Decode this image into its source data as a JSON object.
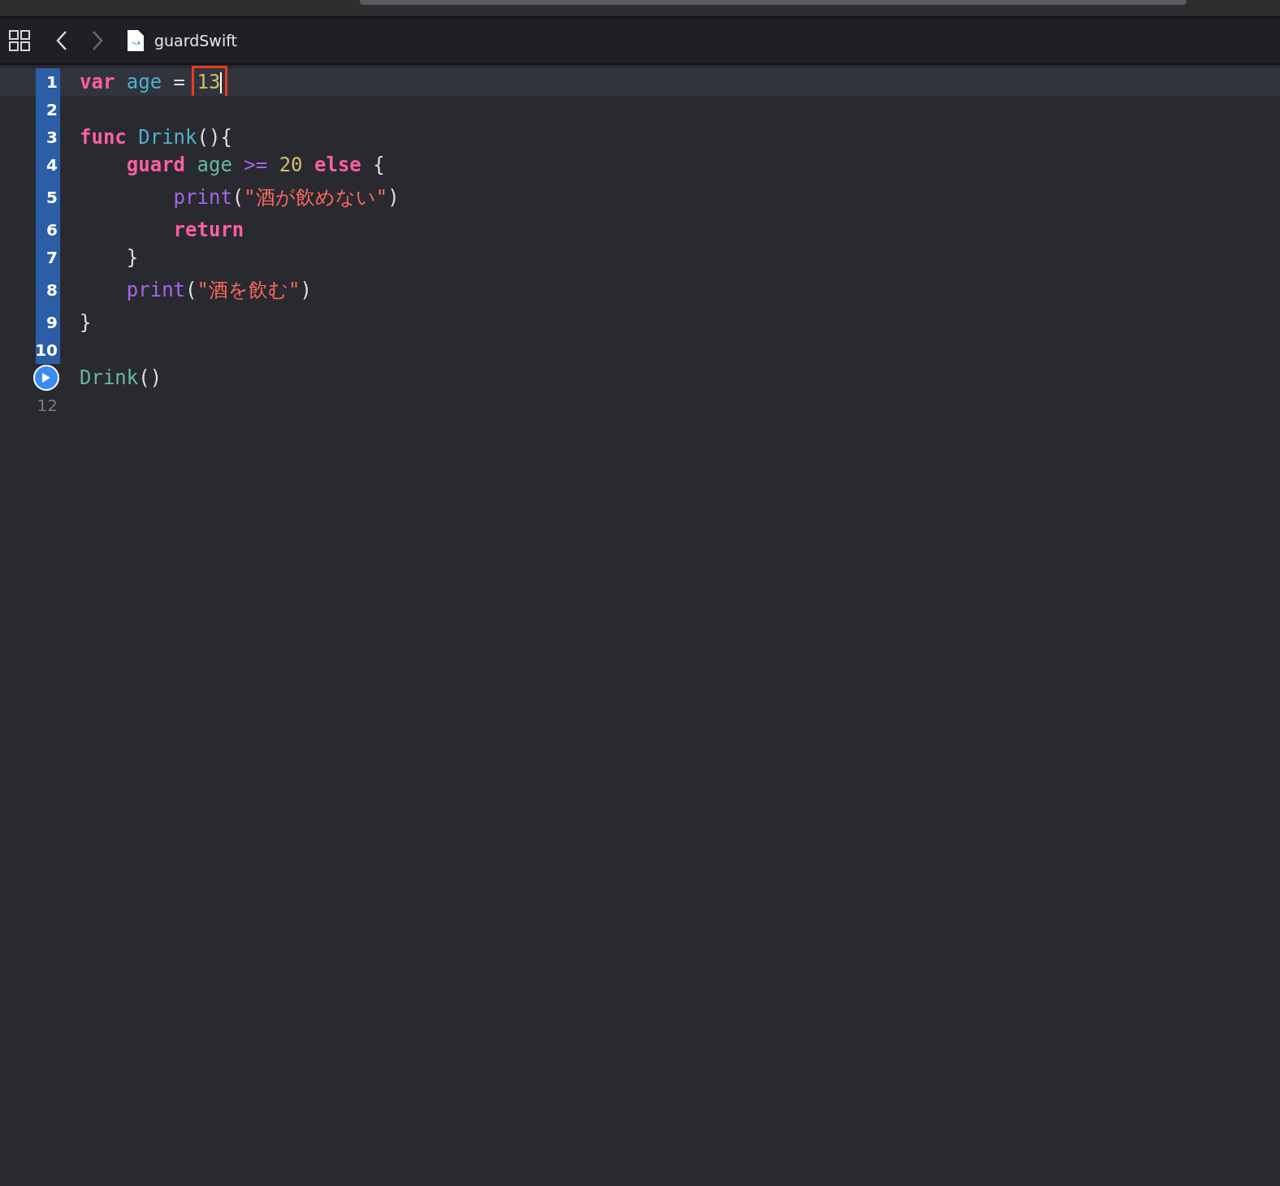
{
  "navigator": {
    "back_enabled": true,
    "forward_enabled": false,
    "file_name": "guardSwift"
  },
  "editor": {
    "lines": [
      {
        "number": "1",
        "kind": "number",
        "executed": true,
        "current": true,
        "tokens": [
          {
            "text": "var",
            "kind": "keyword"
          },
          {
            "text": " age",
            "kind": "decl"
          },
          {
            "text": " = ",
            "kind": "plain"
          },
          {
            "text": "13",
            "kind": "number",
            "boxed": true,
            "cursor": true
          }
        ]
      },
      {
        "number": "2",
        "kind": "number",
        "executed": true,
        "current": false
      },
      {
        "number": "3",
        "kind": "number",
        "executed": true,
        "current": false,
        "tokens": [
          {
            "text": "func",
            "kind": "keyword"
          },
          {
            "text": " Drink",
            "kind": "decl"
          },
          {
            "text": "(){",
            "kind": "plain"
          }
        ]
      },
      {
        "number": "4",
        "kind": "number",
        "executed": true,
        "current": false,
        "tokens": [
          {
            "text": "    guard",
            "kind": "keyword"
          },
          {
            "text": " age",
            "kind": "ident"
          },
          {
            "text": " >=",
            "kind": "func"
          },
          {
            "text": " 20",
            "kind": "number"
          },
          {
            "text": " else",
            "kind": "keyword"
          },
          {
            "text": " {",
            "kind": "plain"
          }
        ]
      },
      {
        "number": "5",
        "kind": "number",
        "executed": true,
        "current": false,
        "tokens": [
          {
            "text": "        print",
            "kind": "func"
          },
          {
            "text": "(",
            "kind": "plain"
          },
          {
            "text": "\"酒が飲めない\"",
            "kind": "string"
          },
          {
            "text": ")",
            "kind": "plain"
          }
        ]
      },
      {
        "number": "6",
        "kind": "number",
        "executed": true,
        "current": false,
        "tokens": [
          {
            "text": "        return",
            "kind": "keyword"
          }
        ]
      },
      {
        "number": "7",
        "kind": "number",
        "executed": true,
        "current": false,
        "tokens": [
          {
            "text": "    }",
            "kind": "plain"
          }
        ]
      },
      {
        "number": "8",
        "kind": "number",
        "executed": true,
        "current": false,
        "tokens": [
          {
            "text": "    print",
            "kind": "func"
          },
          {
            "text": "(",
            "kind": "plain"
          },
          {
            "text": "\"酒を飲む\"",
            "kind": "string"
          },
          {
            "text": ")",
            "kind": "plain"
          }
        ]
      },
      {
        "number": "9",
        "kind": "number",
        "executed": true,
        "current": false,
        "tokens": [
          {
            "text": "}",
            "kind": "plain"
          }
        ]
      },
      {
        "number": "10",
        "kind": "number",
        "executed": true,
        "current": false
      },
      {
        "kind": "run",
        "executed": false,
        "current": false,
        "tokens": [
          {
            "text": "Drink",
            "kind": "ident"
          },
          {
            "text": "()",
            "kind": "plain"
          }
        ]
      },
      {
        "number": "12",
        "kind": "number",
        "executed": false,
        "current": false
      }
    ]
  }
}
